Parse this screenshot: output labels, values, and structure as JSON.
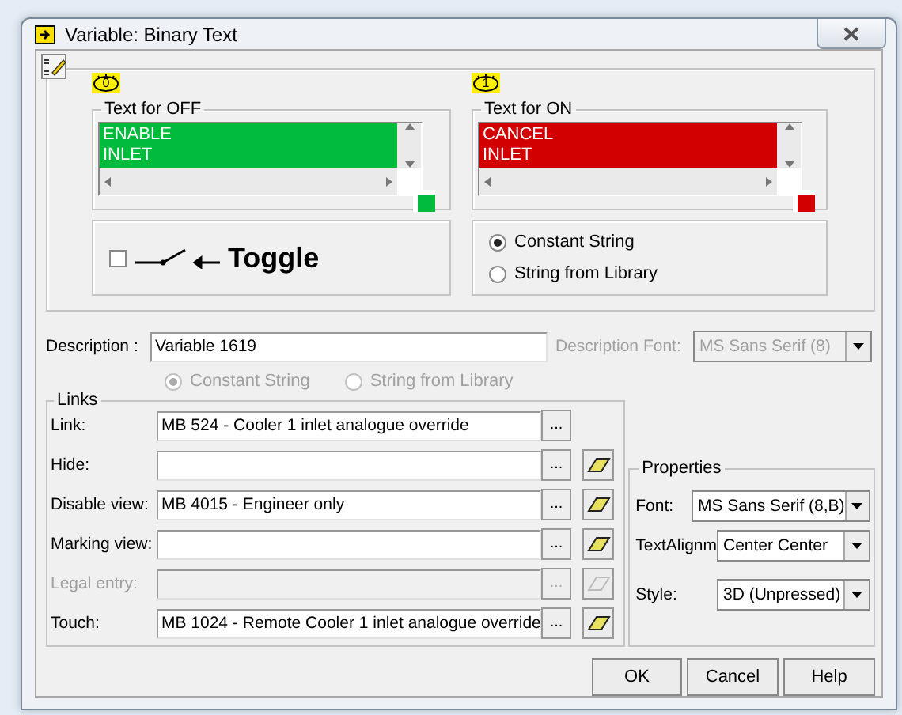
{
  "window": {
    "title": "Variable: Binary Text"
  },
  "states": [
    {
      "badge": "0",
      "legend": "Text for OFF",
      "lines": [
        "ENABLE",
        "INLET"
      ],
      "color": "#00bb3c"
    },
    {
      "badge": "1",
      "legend": "Text for ON",
      "lines": [
        "CANCEL",
        "INLET"
      ],
      "color": "#d20000"
    }
  ],
  "toggle": {
    "checked": false,
    "label": "Toggle"
  },
  "string_source": [
    {
      "label": "Constant String",
      "selected": true
    },
    {
      "label": "String from Library",
      "selected": false
    }
  ],
  "description": {
    "label": "Description :",
    "value": "Variable 1619",
    "font_label": "Description Font:",
    "font_value": "MS Sans Serif (8)"
  },
  "description_source": [
    {
      "label": "Constant String",
      "selected": true,
      "disabled": true
    },
    {
      "label": "String from Library",
      "selected": false,
      "disabled": true
    }
  ],
  "links": {
    "title": "Links",
    "rows": [
      {
        "label": "Link:",
        "value": "MB 524  - Cooler 1 inlet analogue override",
        "disabled": false,
        "eraser": false
      },
      {
        "label": "Hide:",
        "value": "",
        "disabled": false,
        "eraser": true
      },
      {
        "label": "Disable view:",
        "value": "MB 4015  - Engineer only",
        "disabled": false,
        "eraser": true
      },
      {
        "label": "Marking view:",
        "value": "",
        "disabled": false,
        "eraser": true
      },
      {
        "label": "Legal entry:",
        "value": "",
        "disabled": true,
        "eraser": true
      },
      {
        "label": "Touch:",
        "value": "MB 1024  - Remote Cooler 1 inlet analogue override",
        "disabled": false,
        "eraser": true
      }
    ],
    "browse": "..."
  },
  "properties": {
    "title": "Properties",
    "fields": [
      {
        "label": "Font:",
        "value": "MS Sans Serif (8,B)"
      },
      {
        "label": "TextAlignm",
        "value": "Center Center"
      },
      {
        "label": "Style:",
        "value": "3D (Unpressed)"
      }
    ]
  },
  "buttons": [
    "OK",
    "Cancel",
    "Help"
  ]
}
